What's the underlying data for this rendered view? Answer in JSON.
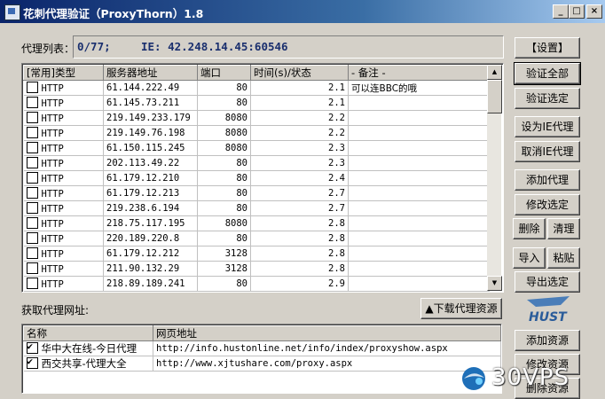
{
  "window": {
    "title": "花刺代理验证（ProxyThorn）1.8",
    "controls": [
      "_",
      "□",
      "×"
    ]
  },
  "info": {
    "label": "代理列表：",
    "count": "0/77;",
    "ie": "IE: 42.248.14.45:60546"
  },
  "proxy_table": {
    "headers": [
      "[常用]类型",
      "服务器地址",
      "端口",
      "时间(s)/状态",
      "- 备注 -"
    ],
    "rows": [
      {
        "type": "HTTP",
        "addr": "61.144.222.49",
        "port": "80",
        "time": "2.1",
        "note": "可以连BBC的哦"
      },
      {
        "type": "HTTP",
        "addr": "61.145.73.211",
        "port": "80",
        "time": "2.1",
        "note": ""
      },
      {
        "type": "HTTP",
        "addr": "219.149.233.179",
        "port": "8080",
        "time": "2.2",
        "note": ""
      },
      {
        "type": "HTTP",
        "addr": "219.149.76.198",
        "port": "8080",
        "time": "2.2",
        "note": ""
      },
      {
        "type": "HTTP",
        "addr": "61.150.115.245",
        "port": "8080",
        "time": "2.3",
        "note": ""
      },
      {
        "type": "HTTP",
        "addr": "202.113.49.22",
        "port": "80",
        "time": "2.3",
        "note": ""
      },
      {
        "type": "HTTP",
        "addr": "61.179.12.210",
        "port": "80",
        "time": "2.4",
        "note": ""
      },
      {
        "type": "HTTP",
        "addr": "61.179.12.213",
        "port": "80",
        "time": "2.7",
        "note": ""
      },
      {
        "type": "HTTP",
        "addr": "219.238.6.194",
        "port": "80",
        "time": "2.7",
        "note": ""
      },
      {
        "type": "HTTP",
        "addr": "218.75.117.195",
        "port": "8080",
        "time": "2.8",
        "note": ""
      },
      {
        "type": "HTTP",
        "addr": "220.189.220.8",
        "port": "80",
        "time": "2.8",
        "note": ""
      },
      {
        "type": "HTTP",
        "addr": "61.179.12.212",
        "port": "3128",
        "time": "2.8",
        "note": ""
      },
      {
        "type": "HTTP",
        "addr": "211.90.132.29",
        "port": "3128",
        "time": "2.8",
        "note": ""
      },
      {
        "type": "HTTP",
        "addr": "218.89.189.241",
        "port": "80",
        "time": "2.9",
        "note": ""
      }
    ]
  },
  "right_buttons": {
    "settings": "【设置】",
    "verify_all": "验证全部",
    "verify_selected": "验证选定",
    "set_ie": "设为IE代理",
    "cancel_ie": "取消IE代理",
    "add_proxy": "添加代理",
    "edit_selected": "修改选定",
    "delete": "删除",
    "clean": "清理",
    "import": "导入",
    "paste": "粘贴",
    "export_selected": "导出选定",
    "add_source": "添加资源",
    "edit_source": "修改资源",
    "delete_source": "删除资源"
  },
  "source_section": {
    "label": "获取代理网址:",
    "download_button": "下载代理资源",
    "headers": [
      "名称",
      "网页地址"
    ],
    "rows": [
      {
        "name": "华中大在线-今日代理",
        "url": "http://info.hustonline.net/info/index/proxyshow.aspx",
        "checked": true
      },
      {
        "name": "西交共享-代理大全",
        "url": "http://www.xjtushare.com/proxy.aspx",
        "checked": true
      }
    ]
  },
  "logo": {
    "text": "HUST"
  },
  "watermark": {
    "text": "30VPS"
  }
}
